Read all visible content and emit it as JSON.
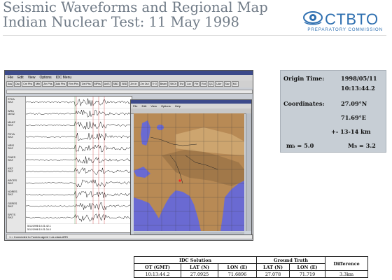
{
  "header": {
    "title_line1": "Seismic Waveforms and Regional Map",
    "title_line2": "Indian Nuclear Test:  11 May 1998",
    "logo_name": "CTBTO",
    "logo_sub": "PREPARATORY COMMISSION"
  },
  "app": {
    "window_title": "ARS",
    "menus": [
      "File",
      "Edit",
      "View",
      "Options",
      "IDC Menu"
    ],
    "toolbar": [
      "Ass",
      "Dsc",
      "Cre Phs",
      "Mth",
      "Zm Phs",
      "Add Phs",
      "Ren Phs",
      "Del Phs",
      "MPhs",
      "AnIS",
      "SBD",
      "SBD",
      "Zm In",
      "Zm Out",
      "Tr 0",
      "Beam",
      "SltCh",
      "Evt",
      "Loc",
      "Fltr",
      "Rot",
      "QC",
      "UArr",
      "Sav",
      "MO"
    ],
    "stations": [
      {
        "code": "STKA",
        "detail": "SHZ"
      },
      {
        "code": "WRA",
        "detail": "cb/SZ"
      },
      {
        "code": "MAKZ",
        "detail": "SHZ"
      },
      {
        "code": "PDYA",
        "detail": "SHZ"
      },
      {
        "code": "NRIS",
        "detail": "SHZ"
      },
      {
        "code": "FINES",
        "detail": "SHZ"
      },
      {
        "code": "KBZ",
        "detail": "SHZ"
      },
      {
        "code": "ARCES",
        "detail": "SHZ"
      },
      {
        "code": "NORES",
        "detail": "SHZ"
      },
      {
        "code": "GERES",
        "detail": "SHZ"
      },
      {
        "code": "SPITS",
        "detail": "SHZ"
      }
    ],
    "time_label_1": "5/11/1998 10:21:42.1",
    "time_label_2": "5/11/1998 10:21:34.0",
    "status": "1 = Connected to Tuxedo agent 1 as class ARS"
  },
  "map_window": {
    "menus": [
      "File",
      "Edit",
      "View",
      "Options",
      "Help"
    ]
  },
  "info": {
    "origin_time_label": "Origin Time:",
    "origin_date": "1998/05/11",
    "origin_time": "10:13:44.2",
    "coordinates_label": "Coordinates:",
    "lat": "27.09°N",
    "lon": "71.69°E",
    "depth": "+- 13-14 km",
    "mb": "m",
    "mb_sub": "b",
    "mb_val": " = 5.0",
    "ms": "M",
    "ms_sub": "S",
    "ms_val": " = 3.2"
  },
  "table": {
    "group1": "IDC Solution",
    "group2": "Ground Truth",
    "difference": "Difference",
    "headers": [
      "OT (GMT)",
      "LAT (N)",
      "LON (E)",
      "LAT (N)",
      "LON (E)"
    ],
    "row": [
      "10:13:44.2",
      "27.0925",
      "71.6896",
      "27.078",
      "71.719",
      "3.3km"
    ]
  }
}
